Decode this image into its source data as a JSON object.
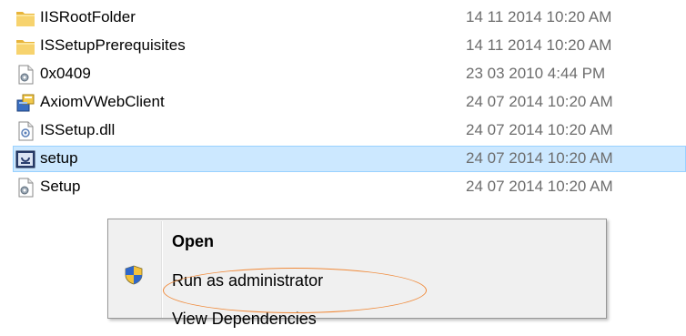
{
  "files": [
    {
      "name": "IISRootFolder",
      "date": "14 11 2014 10:20 AM",
      "icon": "folder-icon"
    },
    {
      "name": "ISSetupPrerequisites",
      "date": "14 11 2014 10:20 AM",
      "icon": "folder-icon"
    },
    {
      "name": "0x0409",
      "date": "23 03 2010 4:44 PM",
      "icon": "settings-file-icon"
    },
    {
      "name": "AxiomVWebClient",
      "date": "24 07 2014 10:20 AM",
      "icon": "installer-package-icon"
    },
    {
      "name": "ISSetup.dll",
      "date": "24 07 2014 10:20 AM",
      "icon": "dll-file-icon"
    },
    {
      "name": "setup",
      "date": "24 07 2014 10:20 AM",
      "icon": "setup-exe-icon",
      "selected": true
    },
    {
      "name": "Setup",
      "date": "24 07 2014 10:20 AM",
      "icon": "settings-file-icon"
    }
  ],
  "context_menu": {
    "items": [
      "Open",
      "Run as administrator",
      "View Dependencies"
    ],
    "shield_icon": "uac-shield-icon"
  },
  "annotation": {
    "color": "#f08a3a"
  }
}
